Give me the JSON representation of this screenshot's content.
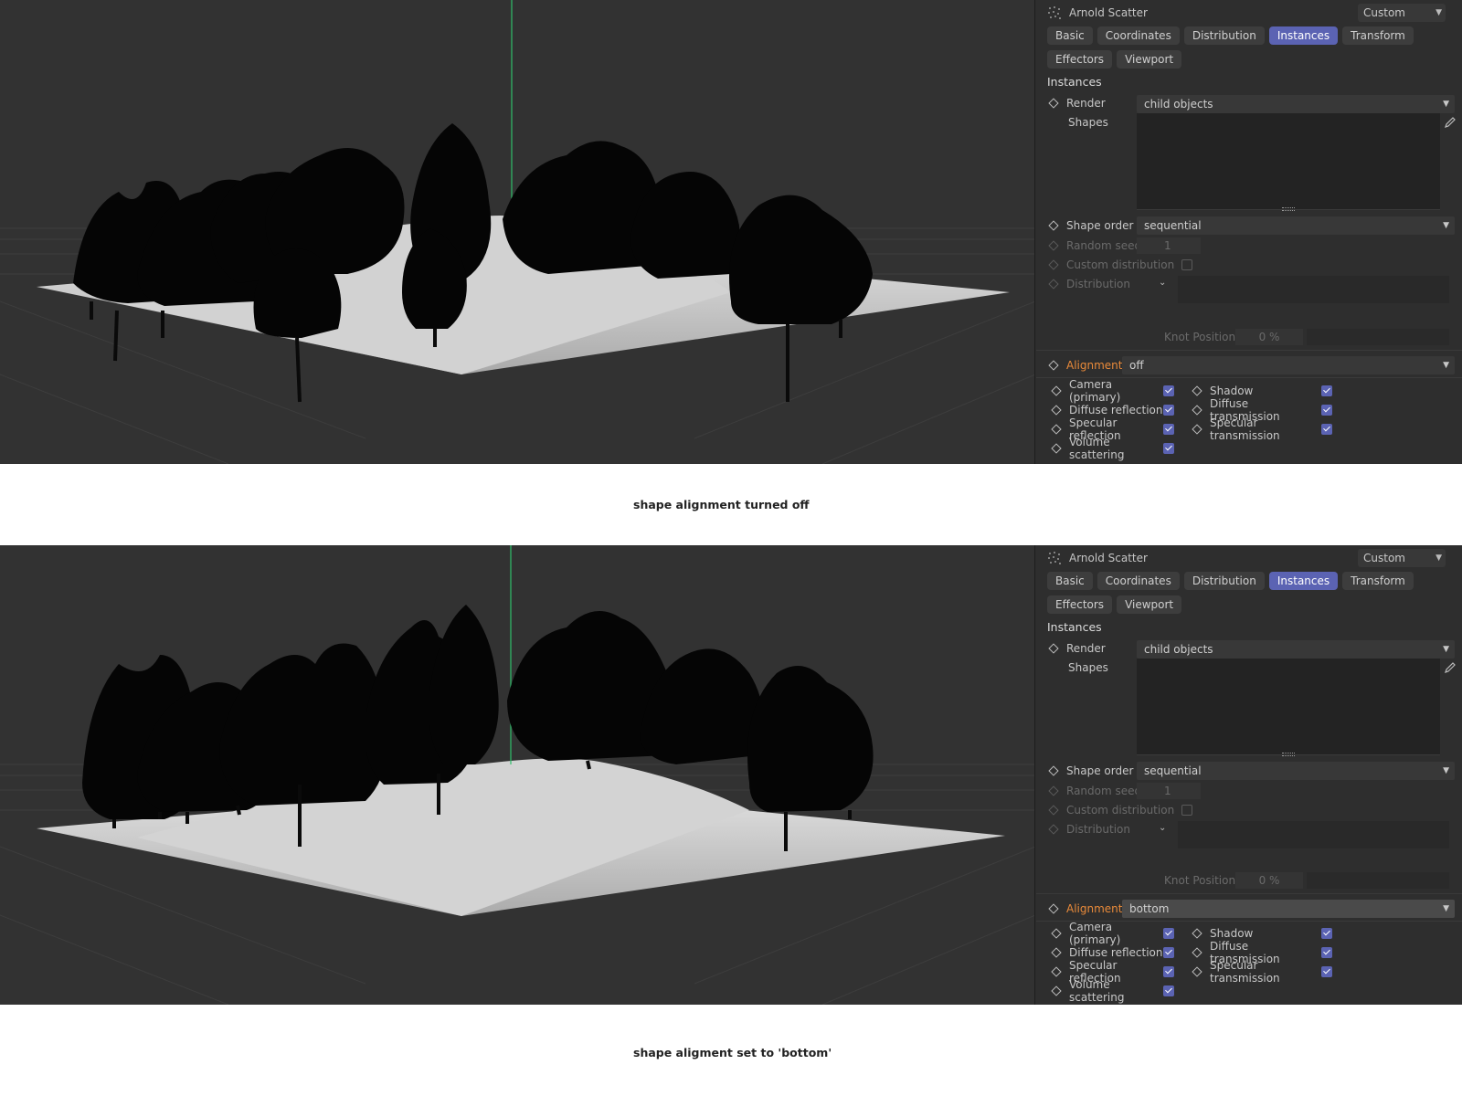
{
  "panels": [
    {
      "title": "Arnold Scatter",
      "preset": "Custom",
      "tabs": [
        {
          "label": "Basic",
          "active": false
        },
        {
          "label": "Coordinates",
          "active": false
        },
        {
          "label": "Distribution",
          "active": false
        },
        {
          "label": "Instances",
          "active": true
        },
        {
          "label": "Transform",
          "active": false
        },
        {
          "label": "Effectors",
          "active": false
        },
        {
          "label": "Viewport",
          "active": false
        }
      ],
      "section_title": "Instances",
      "render_label": "Render",
      "render_value": "child objects",
      "shapes_label": "Shapes",
      "shape_order_label": "Shape order",
      "shape_order_value": "sequential",
      "random_seed_label": "Random seed",
      "random_seed_value": "1",
      "custom_distribution_label": "Custom distribution",
      "distribution_label": "Distribution",
      "knot_position_label": "Knot Position",
      "knot_position_value": "0 %",
      "alignment_label": "Alignment",
      "alignment_value": "off",
      "visibility": [
        {
          "label": "Camera (primary)",
          "checked": true
        },
        {
          "label": "Shadow",
          "checked": true
        },
        {
          "label": "Diffuse reflection",
          "checked": true
        },
        {
          "label": "Diffuse transmission",
          "checked": true
        },
        {
          "label": "Specular reflection",
          "checked": true
        },
        {
          "label": "Specular transmission",
          "checked": true
        },
        {
          "label": "Volume scattering",
          "checked": true
        }
      ],
      "caption": "shape alignment turned off"
    },
    {
      "title": "Arnold Scatter",
      "preset": "Custom",
      "tabs": [
        {
          "label": "Basic",
          "active": false
        },
        {
          "label": "Coordinates",
          "active": false
        },
        {
          "label": "Distribution",
          "active": false
        },
        {
          "label": "Instances",
          "active": true
        },
        {
          "label": "Transform",
          "active": false
        },
        {
          "label": "Effectors",
          "active": false
        },
        {
          "label": "Viewport",
          "active": false
        }
      ],
      "section_title": "Instances",
      "render_label": "Render",
      "render_value": "child objects",
      "shapes_label": "Shapes",
      "shape_order_label": "Shape order",
      "shape_order_value": "sequential",
      "random_seed_label": "Random seed",
      "random_seed_value": "1",
      "custom_distribution_label": "Custom distribution",
      "distribution_label": "Distribution",
      "knot_position_label": "Knot Position",
      "knot_position_value": "0 %",
      "alignment_label": "Alignment",
      "alignment_value": "bottom",
      "visibility": [
        {
          "label": "Camera (primary)",
          "checked": true
        },
        {
          "label": "Shadow",
          "checked": true
        },
        {
          "label": "Diffuse reflection",
          "checked": true
        },
        {
          "label": "Diffuse transmission",
          "checked": true
        },
        {
          "label": "Specular reflection",
          "checked": true
        },
        {
          "label": "Specular transmission",
          "checked": true
        },
        {
          "label": "Volume scattering",
          "checked": true
        }
      ],
      "caption": "shape aligment set to 'bottom'"
    }
  ],
  "colors": {
    "accent": "#5b63b3",
    "alignment_label": "#e98a3a",
    "viewport_bg": "#323232",
    "panel_bg": "#2e2e2e",
    "ground": "#c9c9c9",
    "trees": "#050505",
    "y_axis": "#2fbf6a"
  }
}
